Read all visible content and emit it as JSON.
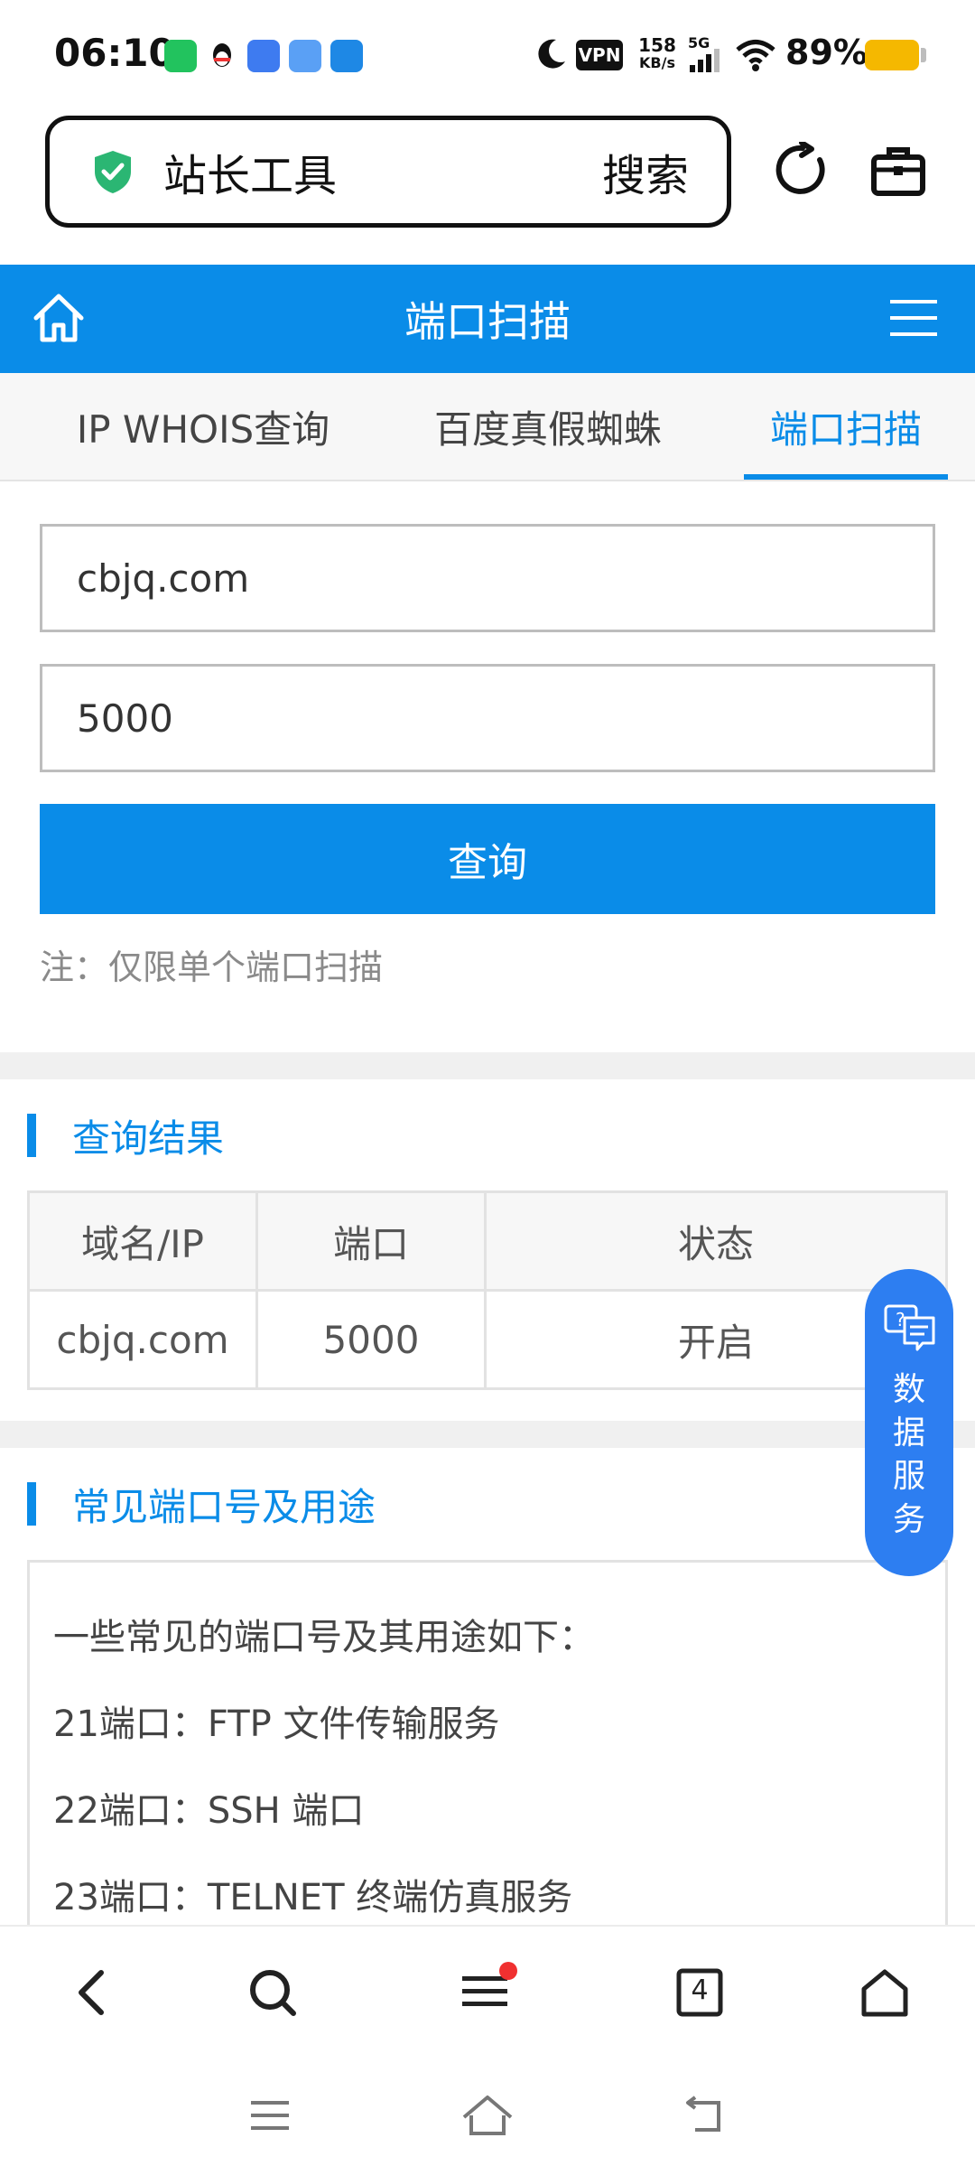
{
  "status_bar": {
    "time": "06:10",
    "vpn": "VPN",
    "speed_value": "158",
    "speed_unit": "KB/s",
    "network": "5G",
    "battery": "89%",
    "battery_color": "#f5b800"
  },
  "browser": {
    "search_text": "站长工具",
    "search_action": "搜索",
    "shield_icon": "shield-check-icon"
  },
  "site": {
    "header_title": "端口扫描",
    "accent": "#0a8ce8"
  },
  "tabs": [
    {
      "label": "IP WHOIS查询"
    },
    {
      "label": "百度真假蜘蛛"
    },
    {
      "label": "端口扫描"
    }
  ],
  "form": {
    "host_value": "cbjq.com",
    "port_value": "5000",
    "submit_label": "查询",
    "note": "注：仅限单个端口扫描"
  },
  "results": {
    "section_title": "查询结果",
    "columns": [
      "域名/IP",
      "端口",
      "状态"
    ],
    "rows": [
      [
        "cbjq.com",
        "5000",
        "开启"
      ]
    ],
    "open_color": "#3aa11c"
  },
  "common_ports": {
    "section_title": "常见端口号及用途",
    "lines": [
      "一些常见的端口号及其用途如下：",
      "21端口：FTP 文件传输服务",
      "22端口：SSH 端口",
      "23端口：TELNET 终端仿真服务"
    ]
  },
  "float_button": {
    "label_1": "数",
    "label_2": "据",
    "label_3": "服",
    "label_4": "务",
    "color": "#2d7ef1"
  },
  "bottom_nav": {
    "tab_count": "4"
  }
}
